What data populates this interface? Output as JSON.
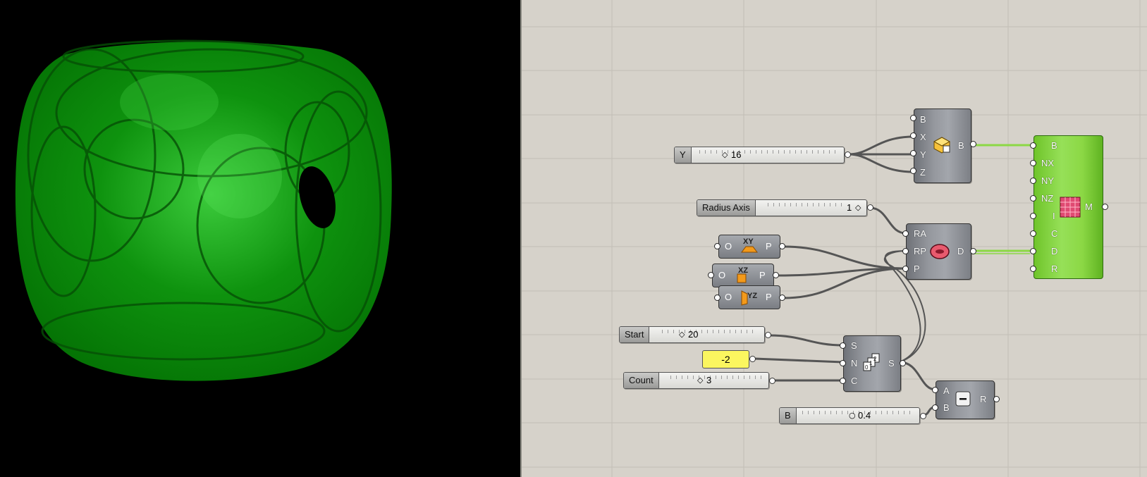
{
  "sliders": {
    "y": {
      "label": "Y",
      "value": "16"
    },
    "radius_axis": {
      "label": "Radius Axis",
      "value": "1"
    },
    "start": {
      "label": "Start",
      "value": "20"
    },
    "count": {
      "label": "Count",
      "value": "3"
    },
    "b": {
      "label": "B",
      "value": "0.4"
    }
  },
  "panel": {
    "value": "-2"
  },
  "box_component": {
    "inputs": [
      "B",
      "X",
      "Y",
      "Z"
    ],
    "output": "B",
    "icon": "box-icon"
  },
  "planes": [
    {
      "name": "XY",
      "input": "O",
      "output": "P",
      "icon": "xy-plane-icon"
    },
    {
      "name": "XZ",
      "input": "O",
      "output": "P",
      "icon": "xz-plane-icon"
    },
    {
      "name": "YZ",
      "input": "O",
      "output": "P",
      "icon": "yz-plane-icon"
    }
  ],
  "cylinder_component": {
    "inputs": [
      "RA",
      "RP",
      "P"
    ],
    "output": "D",
    "icon": "distance-ring-icon"
  },
  "series_component": {
    "inputs": [
      "S",
      "N",
      "C"
    ],
    "output": "S",
    "icon": "series-icon"
  },
  "subtract_component": {
    "inputs": [
      "A",
      "B"
    ],
    "output": "R",
    "icon": "minus-icon"
  },
  "mesh_component": {
    "inputs": [
      "B",
      "NX",
      "NY",
      "NZ",
      "I",
      "C",
      "D",
      "R"
    ],
    "output": "M",
    "icon": "mesh-grid-icon"
  },
  "colors": {
    "canvas": "#d6d2ca",
    "viewport": "#000000",
    "mesh_green": "#00a000",
    "wire": "#555555",
    "wire_green": "#8cd845"
  }
}
